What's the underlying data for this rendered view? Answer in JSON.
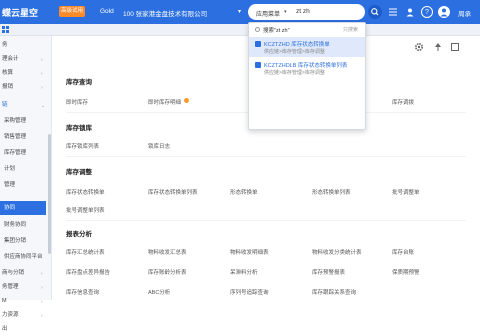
{
  "header": {
    "logo": "蝶云星空",
    "trial_badge": "高级试用",
    "edition": "Gold",
    "company": "100 张家港金盘技术有限公司",
    "search_scope": "应用菜单",
    "search_value": "zt zh",
    "user_name": "周承"
  },
  "dropdown": {
    "search_hint": "搜索\"zt zh\"",
    "search_hint_tag": "只搜索",
    "results": [
      {
        "title": "KCZTZHD 库存状态转换单",
        "path": "供应链>库存管理>库存调整"
      },
      {
        "title": "KCZTZHDLB 库存状态转换单列表",
        "path": "供应链>库存管理>库存调整"
      }
    ]
  },
  "sidebar": {
    "items": [
      {
        "label": "务"
      },
      {
        "label": "理会计"
      },
      {
        "label": "核算"
      },
      {
        "label": "报销"
      },
      {
        "label": "链"
      },
      {
        "label": "采购管理"
      },
      {
        "label": "销售管理"
      },
      {
        "label": "库存管理"
      },
      {
        "label": "计划"
      },
      {
        "label": "管理"
      },
      {
        "label": "协同"
      },
      {
        "label": "财务协同"
      },
      {
        "label": "集团分销"
      },
      {
        "label": "供应商协同平台"
      },
      {
        "label": "商与分销"
      },
      {
        "label": "务管理"
      },
      {
        "label": "M"
      },
      {
        "label": "力资源"
      },
      {
        "label": "出"
      }
    ]
  },
  "sections": {
    "query": {
      "title": "库存查询",
      "links": [
        "即时库存",
        "即时库存明细",
        "",
        "",
        "库存调拨"
      ]
    },
    "lock": {
      "title": "库存锁库",
      "links": [
        "库存锁库列表",
        "锁库日志"
      ]
    },
    "adjust": {
      "title": "库存调整",
      "links": [
        "库存状态转换单",
        "库存状态转换单列表",
        "形态转换单",
        "形态转换单列表",
        "批号调整单",
        "批号调整单列表"
      ]
    },
    "report": {
      "title": "报表分析",
      "links": [
        "库存汇总统计表",
        "物料收发汇总表",
        "物料收发明细表",
        "物料收发分类统计表",
        "库存台账",
        "库存盘点差异报告",
        "库存账龄分析表",
        "呆滞料分析",
        "库存预警报表",
        "保质期预警",
        "库存信息查询",
        "ABC分析",
        "序列号追踪查询",
        "库存跟踪关系查询",
        ""
      ]
    }
  }
}
